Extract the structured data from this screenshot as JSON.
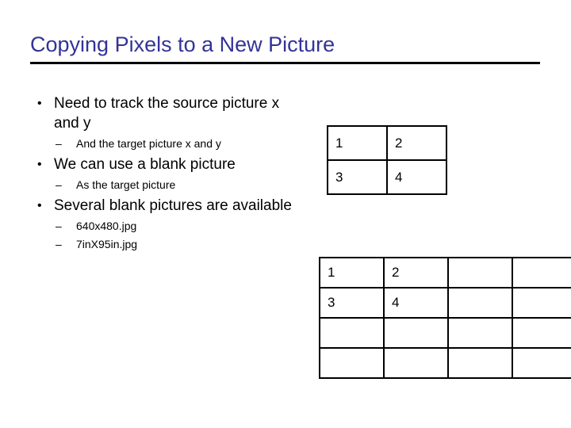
{
  "slide": {
    "title": "Copying Pixels to a New Picture",
    "title_color": "#333399",
    "rule_color": "#000000",
    "background_color": "#ffffff",
    "body_text_color": "#000000"
  },
  "bullets": {
    "marker_level1": "•",
    "marker_level2": "–",
    "groups": [
      {
        "level1": "Need to track the source picture x and y",
        "level2": [
          "And the target picture x and y"
        ]
      },
      {
        "level1": "We can use a blank picture",
        "level2": [
          "As the target picture"
        ]
      },
      {
        "level1": "Several blank pictures are available",
        "level2": [
          "640x480.jpg",
          "7inX95in.jpg"
        ]
      }
    ]
  },
  "tables": {
    "top": {
      "rows": 2,
      "cols": 2,
      "cells": [
        [
          "1",
          "2"
        ],
        [
          "3",
          "4"
        ]
      ]
    },
    "bottom": {
      "rows": 4,
      "cols": 4,
      "cells": [
        [
          "1",
          "2",
          "",
          ""
        ],
        [
          "3",
          "4",
          "",
          ""
        ],
        [
          "",
          "",
          "",
          ""
        ],
        [
          "",
          "",
          "",
          ""
        ]
      ]
    }
  }
}
